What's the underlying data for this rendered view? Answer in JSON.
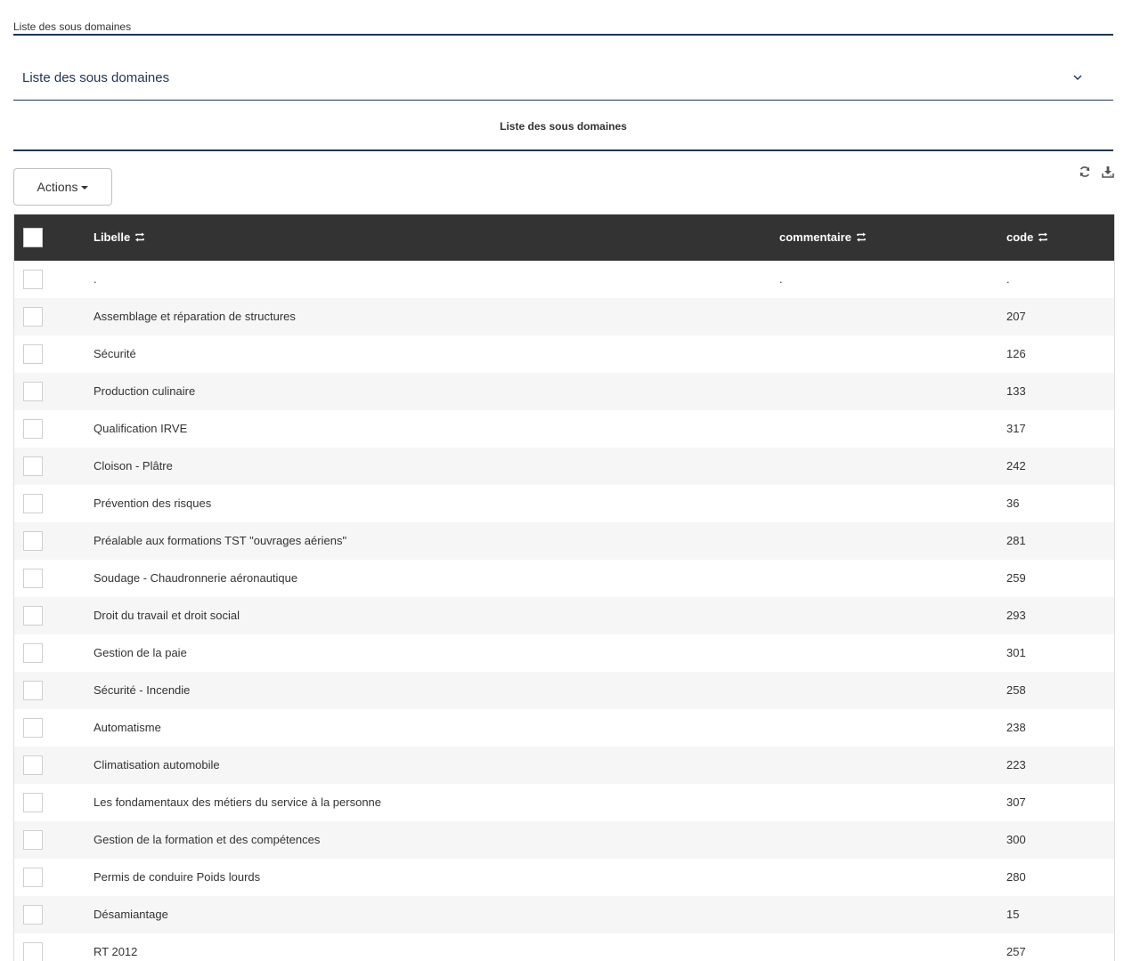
{
  "breadcrumb": {
    "current": "Liste des sous domaines"
  },
  "panel": {
    "title": "Liste des sous domaines"
  },
  "section": {
    "title": "Liste des sous domaines"
  },
  "toolbar": {
    "actions_label": "Actions",
    "refresh_icon": "refresh-icon",
    "download_icon": "download-icon"
  },
  "table": {
    "columns": {
      "libelle": "Libelle",
      "commentaire": "commentaire",
      "code": "code"
    },
    "rows": [
      {
        "libelle": ".",
        "commentaire": ".",
        "code": "."
      },
      {
        "libelle": "Assemblage et réparation de structures",
        "commentaire": "",
        "code": "207"
      },
      {
        "libelle": "Sécurité",
        "commentaire": "",
        "code": "126"
      },
      {
        "libelle": "Production culinaire",
        "commentaire": "",
        "code": "133"
      },
      {
        "libelle": "Qualification IRVE",
        "commentaire": "",
        "code": "317"
      },
      {
        "libelle": "Cloison - Plâtre",
        "commentaire": "",
        "code": "242"
      },
      {
        "libelle": "Prévention des risques",
        "commentaire": "",
        "code": "36"
      },
      {
        "libelle": "Préalable aux formations TST \"ouvrages aériens\"",
        "commentaire": "",
        "code": "281"
      },
      {
        "libelle": "Soudage - Chaudronnerie aéronautique",
        "commentaire": "",
        "code": "259"
      },
      {
        "libelle": "Droit du travail et droit social",
        "commentaire": "",
        "code": "293"
      },
      {
        "libelle": "Gestion de la paie",
        "commentaire": "",
        "code": "301"
      },
      {
        "libelle": "Sécurité - Incendie",
        "commentaire": "",
        "code": "258"
      },
      {
        "libelle": "Automatisme",
        "commentaire": "",
        "code": "238"
      },
      {
        "libelle": "Climatisation automobile",
        "commentaire": "",
        "code": "223"
      },
      {
        "libelle": "Les fondamentaux des métiers du service à la personne",
        "commentaire": "",
        "code": "307"
      },
      {
        "libelle": "Gestion de la formation et des compétences",
        "commentaire": "",
        "code": "300"
      },
      {
        "libelle": "Permis de conduire Poids lourds",
        "commentaire": "",
        "code": "280"
      },
      {
        "libelle": "Désamiantage",
        "commentaire": "",
        "code": "15"
      },
      {
        "libelle": "RT 2012",
        "commentaire": "",
        "code": "257"
      }
    ]
  },
  "colors": {
    "accent": "#1d3557",
    "header_bg": "#333333",
    "row_alt": "#f6f6f6"
  }
}
